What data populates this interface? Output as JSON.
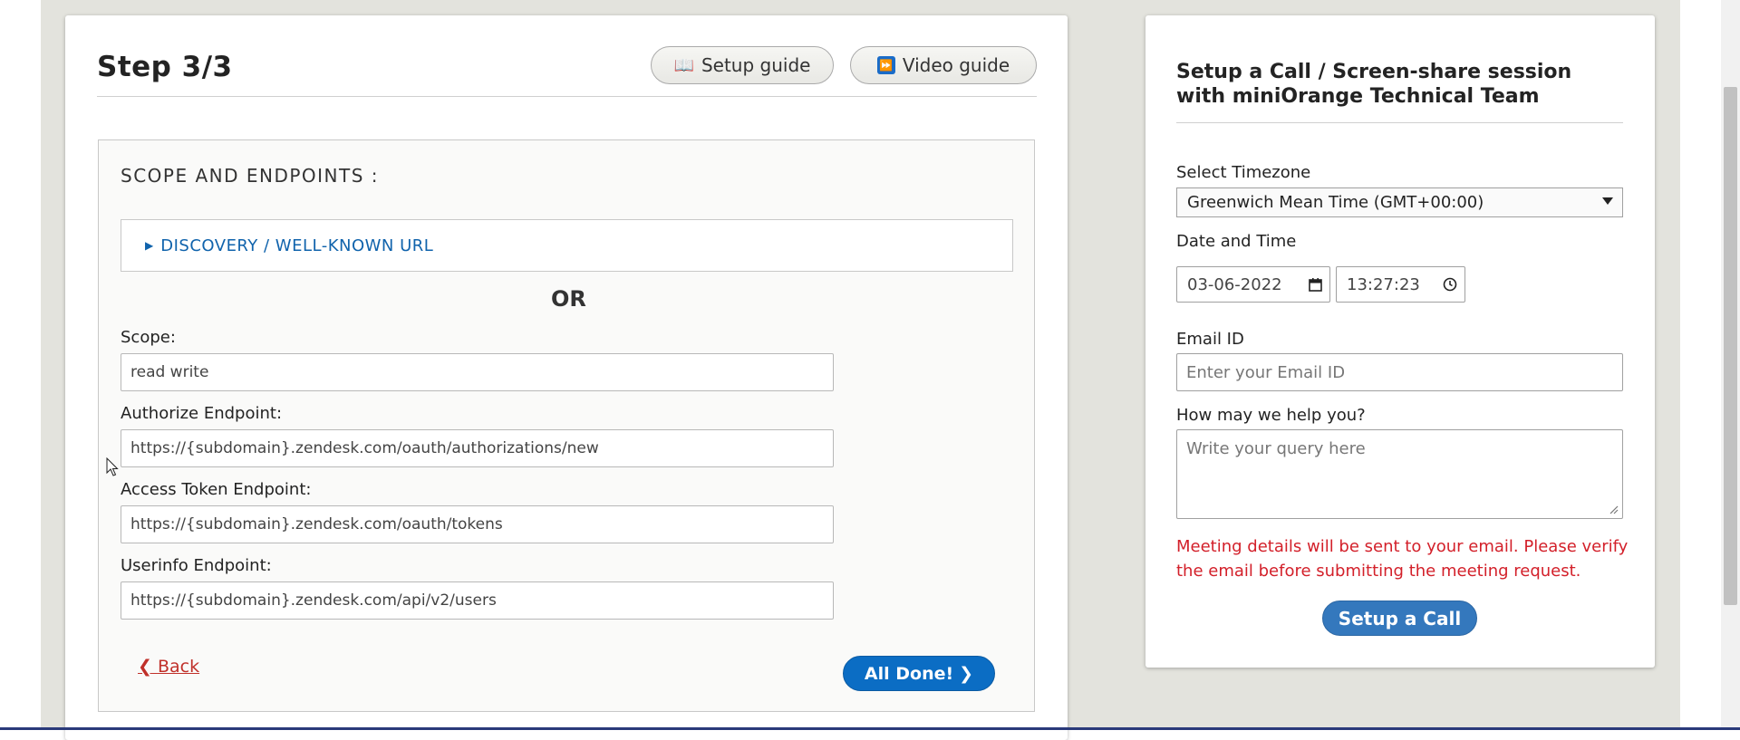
{
  "step": {
    "title": "Step 3/3"
  },
  "guides": {
    "setup_label": "Setup guide",
    "video_label": "Video guide"
  },
  "scope_section": {
    "title": "SCOPE AND ENDPOINTS :",
    "discovery_label": "DISCOVERY / WELL-KNOWN URL",
    "or_label": "OR",
    "fields": [
      {
        "label": "Scope:",
        "value": "read write"
      },
      {
        "label": "Authorize Endpoint:",
        "value": "https://{subdomain}.zendesk.com/oauth/authorizations/new"
      },
      {
        "label": "Access Token Endpoint:",
        "value": "https://{subdomain}.zendesk.com/oauth/tokens"
      },
      {
        "label": "Userinfo Endpoint:",
        "value": "https://{subdomain}.zendesk.com/api/v2/users"
      }
    ],
    "back_label": "Back",
    "done_label": "All Done!"
  },
  "call_panel": {
    "title": "Setup a Call / Screen-share session with miniOrange Technical Team",
    "timezone_label": "Select Timezone",
    "timezone_value": "Greenwich Mean Time (GMT+00:00)",
    "datetime_label": "Date and Time",
    "date_value": "03-06-2022",
    "time_value": "13:27:23",
    "email_label": "Email ID",
    "email_placeholder": "Enter your Email ID",
    "help_label": "How may we help you?",
    "help_placeholder": "Write your query here",
    "warning_text": "Meeting details will be sent to your email. Please verify the email before submitting the meeting request.",
    "call_button_label": "Setup a Call"
  },
  "icons": {
    "setup_guide": "book-icon",
    "video_guide": "video-play-icon",
    "discovery": "triangle-right-icon",
    "back": "chevron-left-icon",
    "done": "chevron-right-icon",
    "date": "calendar-icon",
    "time": "clock-icon"
  },
  "colors": {
    "link_blue": "#1063ac",
    "primary_button": "#0b6dc4",
    "warning_red": "#d3202a",
    "back_link": "#c0302a",
    "page_bg": "#e3e3dd"
  }
}
